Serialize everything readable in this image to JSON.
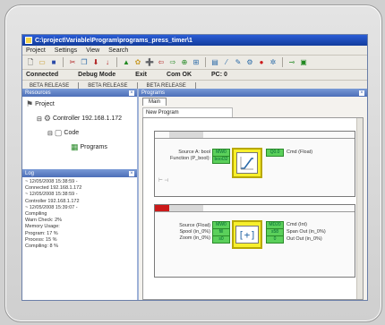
{
  "window": {
    "title": "C:\\project\\Variable\\Program\\programs_press_timer\\1"
  },
  "menu": [
    "Project",
    "Settings",
    "View",
    "Search"
  ],
  "toolbar_icons": [
    "new-icon",
    "open-icon",
    "save-icon",
    "cut-icon",
    "copy-icon",
    "paste-icon",
    "download-icon",
    "upload-icon",
    "run-icon",
    "stop-icon",
    "next-icon",
    "prev-icon",
    "zoom-in-icon",
    "zoom-out-icon",
    "tools-icon",
    "edit-icon",
    "link-icon",
    "settings-icon",
    "record-icon",
    "help-icon",
    "minimize-icon",
    "maximize-icon"
  ],
  "status": {
    "mode1": "Connected",
    "mode2": "Debug Mode",
    "mode3": "Exit",
    "conn": "Com OK",
    "pc": "PC: 0"
  },
  "beta_tabs": [
    "BETA RELEASE",
    "BETA RELEASE",
    "BETA RELEASE"
  ],
  "left_panel": {
    "project_header": "Resources",
    "tree": {
      "root": "Project",
      "controller": "Controller 192.168.1.172",
      "code": "Code",
      "program": "Programs"
    },
    "log_header": "Log",
    "log_lines": [
      "~ 12/05/2008 15:38:59 -",
      "     Connected 192.168.1.172",
      "~ 12/05/2008 15:38:59 -",
      "     Controller 192.168.1.172",
      "~ 12/05/2008 15:39:07 -",
      "     Compiling",
      "     Warn Check:  2%",
      "     Memory Usage:",
      "       Program:  17 %",
      "       Process:  15 %",
      "       Compiling: 8 %"
    ]
  },
  "right_panel": {
    "header": "Programs",
    "tab": "Main",
    "network_name": "New Program",
    "rung1": {
      "params": [
        "Source A: bool",
        "Function (P_bool):"
      ],
      "cells": [
        "MW0",
        "bool32",
        "Q0.0",
        "bool"
      ],
      "out_label": "Cmd (Float)"
    },
    "rung2": {
      "params": [
        "Source (Float)",
        "Spool (in_0%)",
        "Zoom (in_0%)"
      ],
      "cells_in": [
        "MW0",
        "fill",
        "s0"
      ],
      "cells_out": [
        "MD20",
        "s58",
        "0"
      ],
      "out_labels": [
        "Cmd (Int)",
        "Span Out (in_0%)",
        "Out Out (in_0%)"
      ]
    }
  },
  "colors": {
    "title_bar": "#1e4fc4",
    "block_yellow": "#f7ef2c",
    "cell_green": "#5bd05b",
    "rung_marker_red": "#cc1a1a"
  }
}
